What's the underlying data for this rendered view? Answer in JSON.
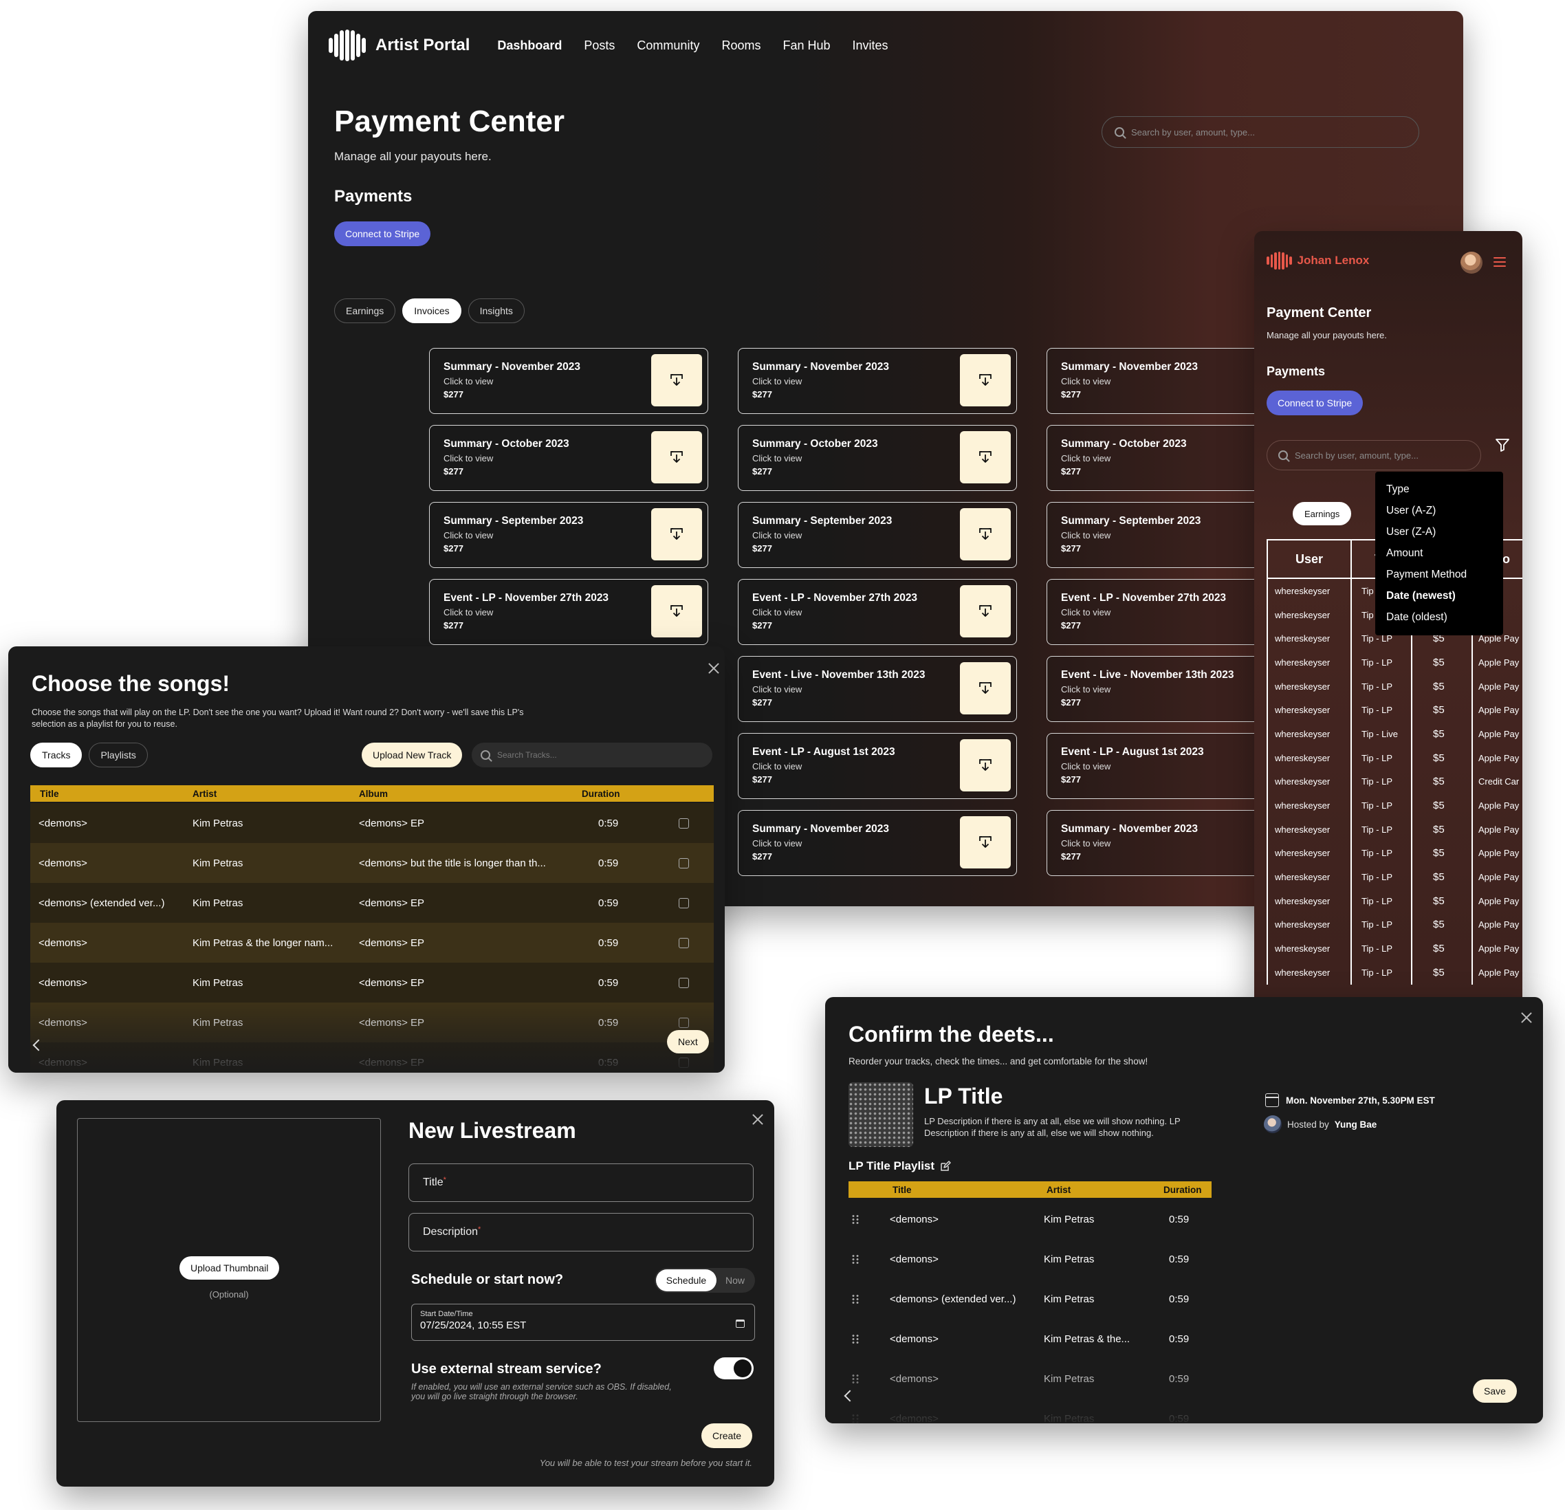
{
  "main": {
    "brand": "Artist Portal",
    "nav": [
      "Dashboard",
      "Posts",
      "Community",
      "Rooms",
      "Fan Hub",
      "Invites"
    ],
    "title": "Payment Center",
    "subtitle": "Manage all your payouts here.",
    "payments_heading": "Payments",
    "stripe_button": "Connect to Stripe",
    "search_placeholder": "Search by user, amount, type...",
    "tabs": [
      "Earnings",
      "Invoices",
      "Insights"
    ],
    "active_tab": "Invoices",
    "click_to_view": "Click to view",
    "cards": [
      [
        "Summary - November 2023",
        "Summary - November 2023",
        "Summary - November 2023"
      ],
      [
        "Summary - October 2023",
        "Summary - October 2023",
        "Summary - October 2023"
      ],
      [
        "Summary - September 2023",
        "Summary - September 2023",
        "Summary - September 2023"
      ],
      [
        "Event - LP - November 27th 2023",
        "Event - LP - November 27th 2023",
        "Event - LP - November 27th 2023"
      ],
      [
        "",
        "Event -  Live - November 13th 2023",
        "Event -  Live - November 13th 2023"
      ],
      [
        "",
        "Event - LP - August 1st 2023",
        "Event - LP - August 1st 2023"
      ],
      [
        "",
        "Summary - November 2023",
        "Summary - November 2023"
      ]
    ],
    "amount": "$277"
  },
  "mobile": {
    "brand": "Johan Lenox",
    "title": "Payment Center",
    "subtitle": "Manage all your payouts here.",
    "payments_heading": "Payments",
    "stripe_button": "Connect to Stripe",
    "search_placeholder": "Search by user, amount, type...",
    "tab_earnings": "Earnings",
    "sort_options": [
      "Type",
      "User (A-Z)",
      "User (Z-A)",
      "Amount",
      "Payment Method",
      "Date (newest)",
      "Date (oldest)"
    ],
    "selected_sort": "Date (newest)",
    "columns": [
      "User",
      "Ty",
      "",
      "tho"
    ],
    "rows": [
      [
        "whereskeyser",
        "Tip",
        "",
        "e Pay"
      ],
      [
        "whereskeyser",
        "Tip",
        "",
        "e Pay"
      ],
      [
        "whereskeyser",
        "Tip - LP",
        "$5",
        "Apple Pay"
      ],
      [
        "whereskeyser",
        "Tip - LP",
        "$5",
        "Apple Pay"
      ],
      [
        "whereskeyser",
        "Tip - LP",
        "$5",
        "Apple Pay"
      ],
      [
        "whereskeyser",
        "Tip - LP",
        "$5",
        "Apple Pay"
      ],
      [
        "whereskeyser",
        "Tip - Live",
        "$5",
        "Apple Pay"
      ],
      [
        "whereskeyser",
        "Tip - LP",
        "$5",
        "Apple Pay"
      ],
      [
        "whereskeyser",
        "Tip - LP",
        "$5",
        "Credit Car"
      ],
      [
        "whereskeyser",
        "Tip - LP",
        "$5",
        "Apple Pay"
      ],
      [
        "whereskeyser",
        "Tip - LP",
        "$5",
        "Apple Pay"
      ],
      [
        "whereskeyser",
        "Tip - LP",
        "$5",
        "Apple Pay"
      ],
      [
        "whereskeyser",
        "Tip - LP",
        "$5",
        "Apple Pay"
      ],
      [
        "whereskeyser",
        "Tip - LP",
        "$5",
        "Apple Pay"
      ],
      [
        "whereskeyser",
        "Tip - LP",
        "$5",
        "Apple Pay"
      ],
      [
        "whereskeyser",
        "Tip - LP",
        "$5",
        "Apple Pay"
      ],
      [
        "whereskeyser",
        "Tip - LP",
        "$5",
        "Apple Pay"
      ]
    ]
  },
  "songs": {
    "title": "Choose the songs!",
    "subtitle": "Choose the songs that will play on the LP. Don't see the one you want? Upload it! Want round 2? Don't worry - we'll save this LP's selection as a playlist for you to reuse.",
    "tabs": [
      "Tracks",
      "Playlists"
    ],
    "upload_button": "Upload New Track",
    "search_placeholder": "Search Tracks...",
    "columns": [
      "Title",
      "Artist",
      "Album",
      "Duration"
    ],
    "rows": [
      [
        "<demons>",
        "Kim Petras",
        "<demons> EP",
        "0:59"
      ],
      [
        "<demons>",
        "Kim Petras",
        "<demons> but the title is longer than th...",
        "0:59"
      ],
      [
        "<demons> (extended ver...)",
        "Kim Petras",
        "<demons> EP",
        "0:59"
      ],
      [
        "<demons>",
        "Kim Petras & the longer nam...",
        "<demons> EP",
        "0:59"
      ],
      [
        "<demons>",
        "Kim Petras",
        "<demons> EP",
        "0:59"
      ],
      [
        "<demons>",
        "Kim Petras",
        "<demons> EP",
        "0:59"
      ],
      [
        "<demons>",
        "Kim Petras",
        "<demons> EP",
        "0:59"
      ]
    ],
    "next_button": "Next"
  },
  "live": {
    "upload_thumbnail": "Upload Thumbnail",
    "optional": "(Optional)",
    "title": "New Livestream",
    "title_field": "Title",
    "description_field": "Description",
    "required_mark": "*",
    "schedule_heading": "Schedule or start now?",
    "schedule_options": [
      "Schedule",
      "Now"
    ],
    "date_label": "Start Date/Time",
    "date_value": "07/25/2024, 10:55 EST",
    "external_heading": "Use external stream service?",
    "external_sub": "If enabled, you will use an external service such as OBS. If disabled, you will go live straight through the browser.",
    "external_enabled": true,
    "create_button": "Create",
    "test_note": "You will be able to test your stream before you start it."
  },
  "confirm": {
    "title": "Confirm the deets...",
    "subtitle": "Reorder your tracks, check the times... and get comfortable for the show!",
    "lp_title": "LP Title",
    "lp_description": "LP Description if there is any at all, else we will show nothing. LP Description if there is any at all, else we will show nothing.",
    "date": "Mon. November 27th, 5.30PM EST",
    "hosted_by_label": "Hosted by",
    "host": "Yung Bae",
    "playlist_title": "LP Title Playlist",
    "columns": [
      "Title",
      "Artist",
      "Duration"
    ],
    "rows": [
      [
        "<demons>",
        "Kim Petras",
        "0:59"
      ],
      [
        "<demons>",
        "Kim Petras",
        "0:59"
      ],
      [
        "<demons> (extended ver...)",
        "Kim Petras",
        "0:59"
      ],
      [
        "<demons>",
        "Kim Petras & the...",
        "0:59"
      ],
      [
        "<demons>",
        "Kim Petras",
        "0:59"
      ],
      [
        "<demons>",
        "Kim Petras",
        "0:59"
      ]
    ],
    "save_button": "Save"
  },
  "colors": {
    "accent": "#5b63d6",
    "gold": "#d4a215",
    "cream": "#fdf3d9",
    "brand_red": "#e8584a"
  }
}
